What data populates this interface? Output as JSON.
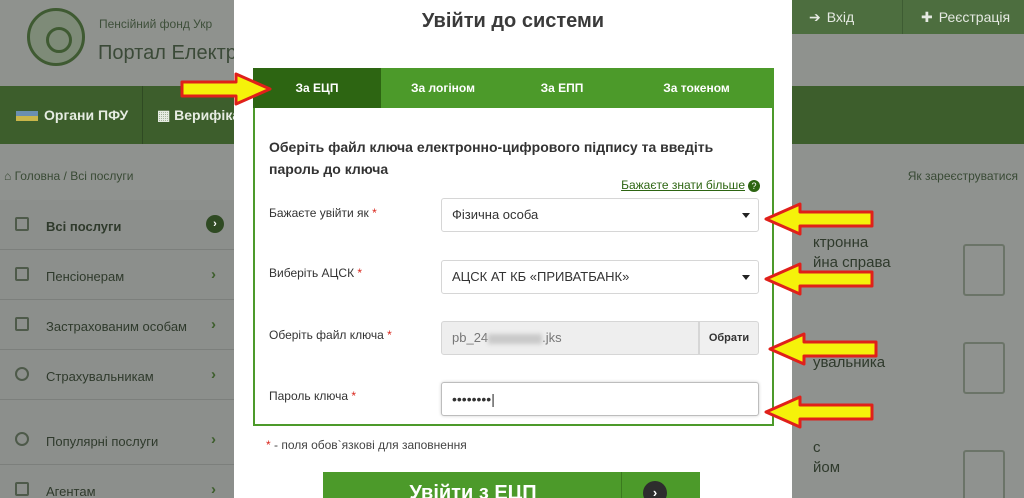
{
  "background": {
    "org_name": "Пенсійний фонд Укр",
    "portal_name": "Портал Електр",
    "top_buttons": [
      {
        "icon": "login-icon",
        "label": "Вхід"
      },
      {
        "icon": "user-plus-icon",
        "label": "Реєстрація"
      }
    ],
    "nav": [
      {
        "label": "Органи ПФУ"
      },
      {
        "label": "Верифіка"
      }
    ],
    "breadcrumb": "Головна / Всі послуги",
    "register_text": "Як зареєструватися",
    "sidebar": [
      {
        "label": "Всі послуги",
        "active": true
      },
      {
        "label": "Пенсіонерам"
      },
      {
        "label": "Застрахованим особам"
      },
      {
        "label": "Страхувальникам"
      },
      {
        "label": "Популярні послуги"
      },
      {
        "label": "Агентам"
      }
    ],
    "right_items": [
      {
        "line1": "ктронна",
        "line2": "йна справа"
      },
      {
        "line1": "увальника"
      },
      {
        "line1": "с",
        "line2": "йом"
      }
    ]
  },
  "modal": {
    "title": "Увійти до системи",
    "tabs": [
      {
        "label": "За ЕЦП",
        "active": true
      },
      {
        "label": "За логіном"
      },
      {
        "label": "За ЕПП"
      },
      {
        "label": "За токеном"
      }
    ],
    "intro": "Оберіть файл ключа електронно-цифрового підпису та введіть пароль до ключа",
    "more_link": "Бажаєте знати більше",
    "fields": {
      "login_as": {
        "label": "Бажаєте увійти як",
        "value": "Фізична особа"
      },
      "acsk": {
        "label": "Виберіть АЦСК",
        "value": "АЦСК АТ КБ «ПРИВАТБАНК»"
      },
      "key_file": {
        "label": "Оберіть файл ключа",
        "value_prefix": "pb_24",
        "value_suffix": ".jks",
        "button": "Обрати"
      },
      "password": {
        "label": "Пароль ключа",
        "value": "••••••••|"
      }
    },
    "required_mark": "*",
    "required_note": " - поля обов`язкові для заповнення",
    "login_button": "Увійти з ЕЦП"
  },
  "colors": {
    "accent_green": "#4c9a2a",
    "dark_green": "#2d6512",
    "arrow_fill": "#f5f20a",
    "arrow_stroke": "#e0201a"
  }
}
